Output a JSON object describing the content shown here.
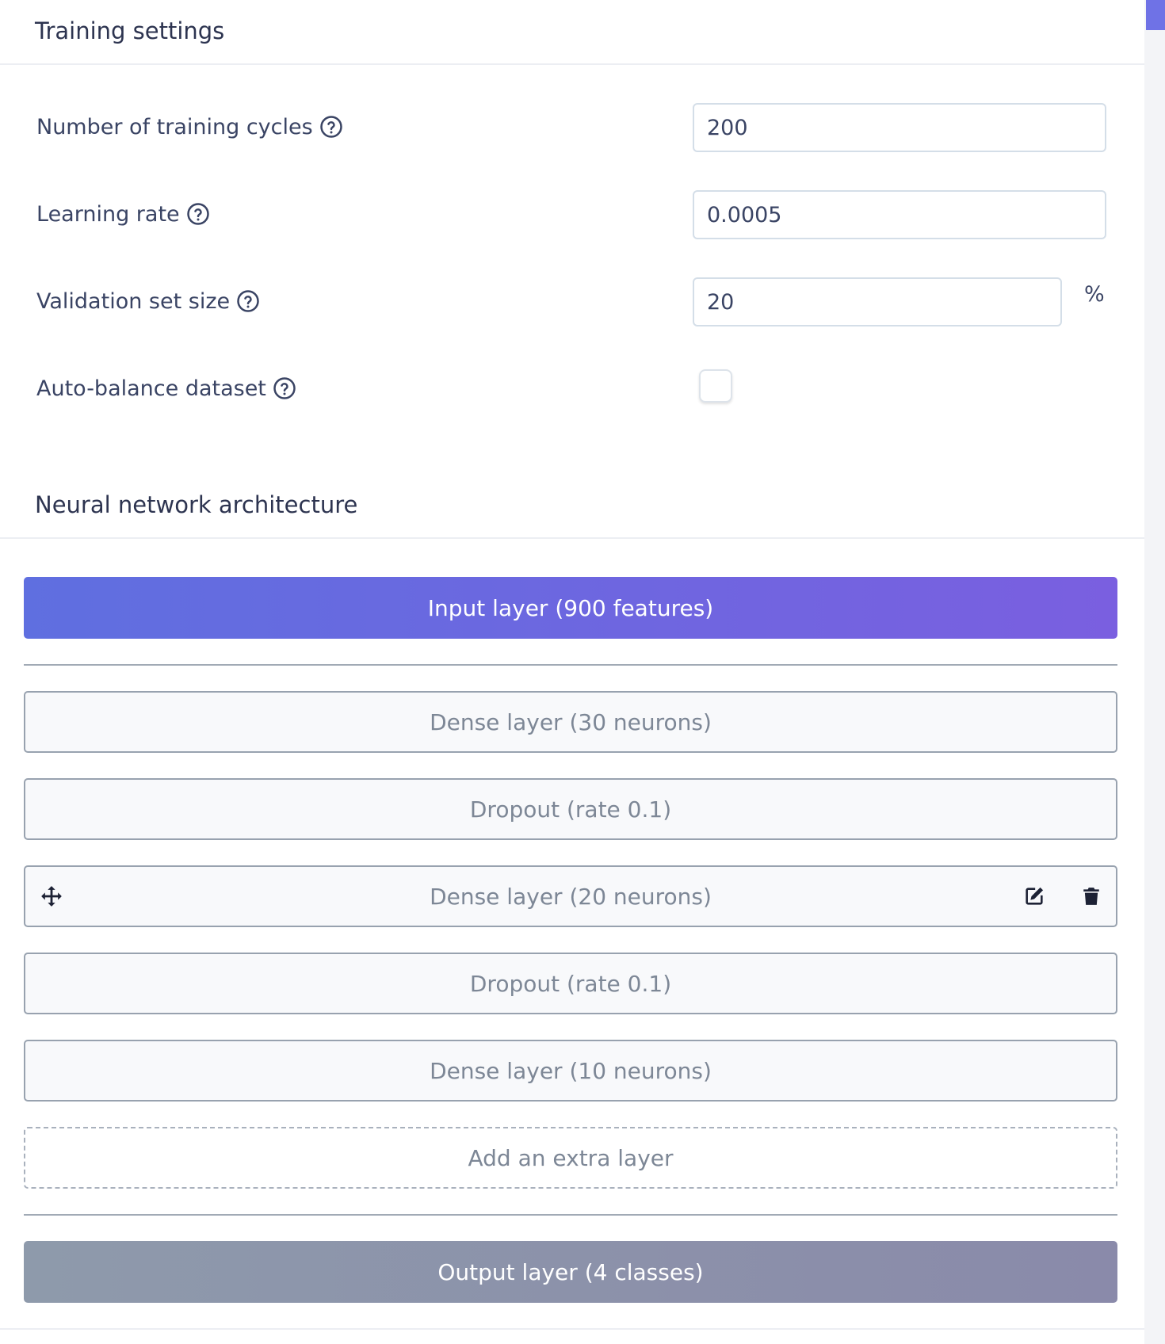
{
  "training_settings": {
    "title": "Training settings",
    "fields": {
      "training_cycles": {
        "label": "Number of training cycles",
        "value": "200"
      },
      "learning_rate": {
        "label": "Learning rate",
        "value": "0.0005"
      },
      "validation_set_size": {
        "label": "Validation set size",
        "value": "20",
        "unit": "%"
      },
      "auto_balance": {
        "label": "Auto-balance dataset",
        "checked": false
      }
    }
  },
  "architecture": {
    "title": "Neural network architecture",
    "input_layer": "Input layer (900 features)",
    "layers": [
      "Dense layer (30 neurons)",
      "Dropout (rate 0.1)",
      "Dense layer (20 neurons)",
      "Dropout (rate 0.1)",
      "Dense layer (10 neurons)"
    ],
    "add_layer": "Add an extra layer",
    "output_layer": "Output layer (4 classes)"
  },
  "icons": {
    "help": "help-circle-icon",
    "move": "move-icon",
    "edit": "edit-icon",
    "delete": "trash-icon"
  },
  "colors": {
    "input_layer_start": "#5f6fe0",
    "input_layer_end": "#7a5fe0",
    "output_layer_start": "#8e9aab",
    "output_layer_end": "#8a8aaa",
    "scrollbar_accent": "#6f72e6"
  }
}
